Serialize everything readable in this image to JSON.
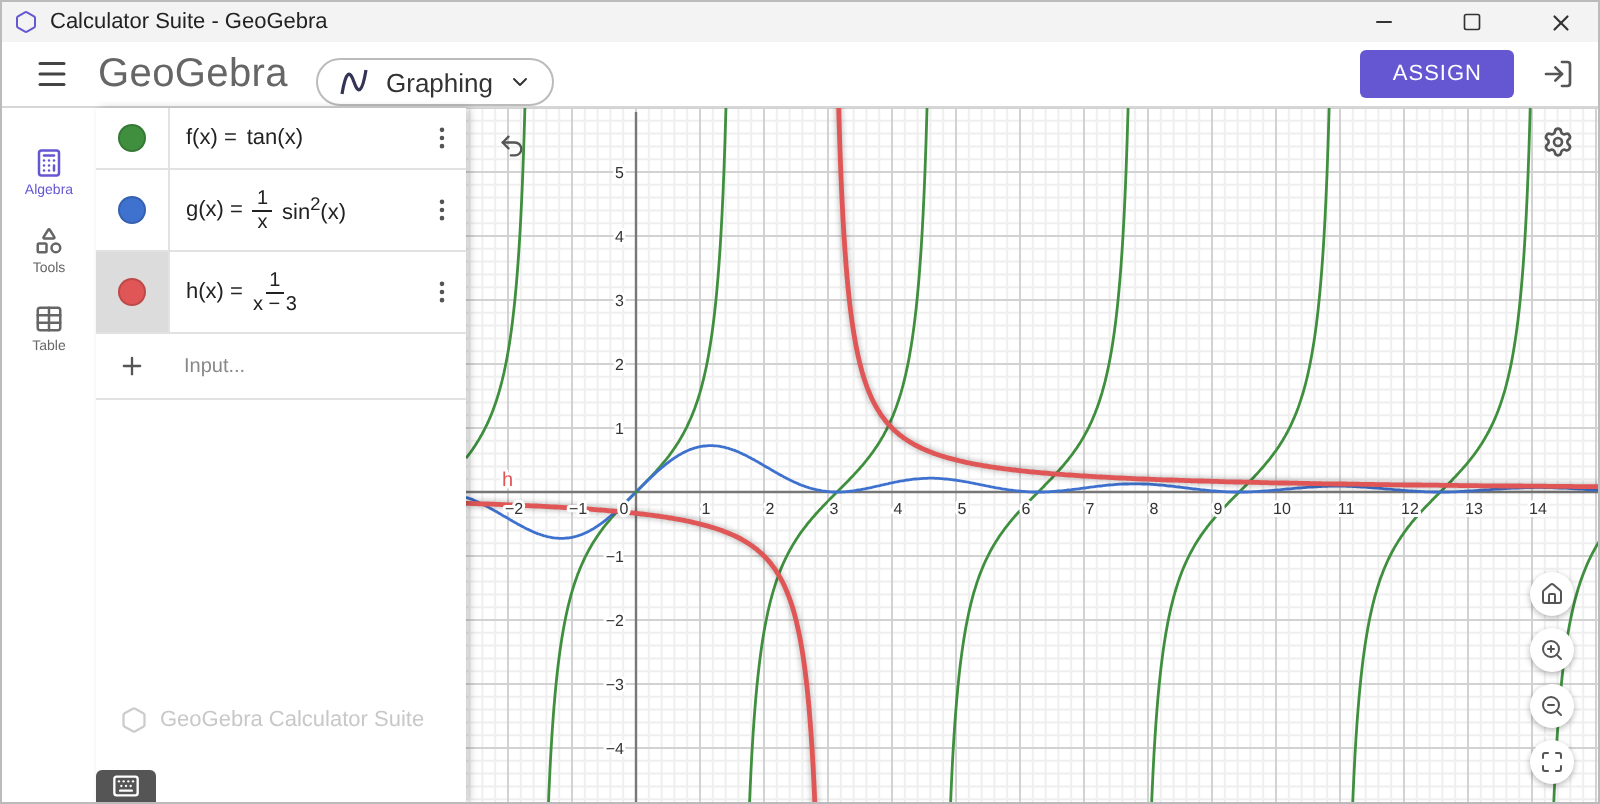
{
  "window": {
    "title": "Calculator Suite - GeoGebra"
  },
  "header": {
    "logo": "GeoGebra",
    "app_picker": "Graphing",
    "assign_button": "ASSIGN"
  },
  "rail": [
    {
      "label": "Algebra",
      "kind": "algebra",
      "selected": true
    },
    {
      "label": "Tools",
      "kind": "tools",
      "selected": false
    },
    {
      "label": "Table",
      "kind": "table",
      "selected": false
    }
  ],
  "algebra": {
    "items": [
      {
        "lhs": "f(x) =",
        "kind": "tangent",
        "expression": "tan(x)",
        "color": "#3f8f3f",
        "selected": false
      },
      {
        "lhs": "g(x) =",
        "kind": "wave",
        "numerator": "1",
        "denominator": "x",
        "tail": "sin$^{2}$(x)",
        "color": "#3f72cf",
        "selected": false
      },
      {
        "lhs": "h(x) =",
        "kind": "hyperbola",
        "numerator": "1",
        "denominator": "x − 3",
        "color": "#e05656",
        "selected": true,
        "graph_label": "h"
      }
    ],
    "input_placeholder": "Input...",
    "footer": "GeoGebra Calculator Suite"
  },
  "graph": {
    "x_ticks": [
      "−2",
      "−1",
      "0",
      "1",
      "2",
      "3",
      "4",
      "5",
      "6",
      "7",
      "8",
      "9",
      "10",
      "11",
      "12",
      "13",
      "14"
    ],
    "y_ticks": [
      "5",
      "4",
      "3",
      "2",
      "1",
      "−1",
      "−2",
      "−3",
      "−4"
    ]
  }
}
